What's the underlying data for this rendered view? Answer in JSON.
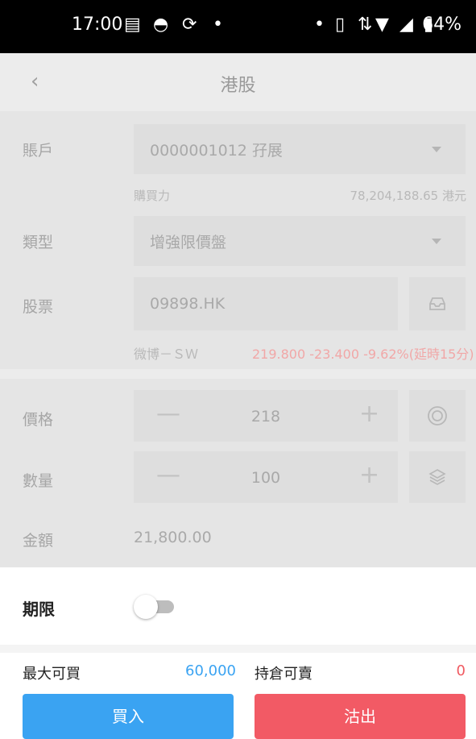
{
  "status_bar": {
    "time": "17:00",
    "battery": "64%",
    "left_icons": [
      "message-icon",
      "bowl-icon",
      "sync-icon",
      "dot-icon"
    ],
    "right_icons": [
      "dot-icon",
      "vibrate-icon",
      "data-icon",
      "wifi-icon",
      "signal-icon",
      "battery-icon"
    ]
  },
  "header": {
    "back_icon": "chevron-left-icon",
    "title": "港股"
  },
  "form": {
    "account_label": "賬戶",
    "account_value": "0000001012 孖展",
    "buying_power_label": "購買力",
    "buying_power_value": "78,204,188.65 港元",
    "type_label": "類型",
    "type_value": "增強限價盤",
    "stock_label": "股票",
    "stock_value": "09898.HK",
    "stock_name": "微博－ＳＷ",
    "quote": "219.800  -23.400  -9.62%(延時15分)",
    "price_label": "價格",
    "price_value": "218",
    "quantity_label": "數量",
    "quantity_value": "100",
    "amount_label": "金額",
    "amount_value": "21,800.00",
    "minus_symbol": "—",
    "plus_symbol": "+"
  },
  "validity": {
    "label": "期限",
    "enabled": false
  },
  "summary": {
    "max_buy_label": "最大可買",
    "max_buy_value": "60,000",
    "holding_sell_label": "持倉可賣",
    "holding_sell_value": "0"
  },
  "actions": {
    "buy_label": "買入",
    "sell_label": "沽出"
  },
  "colors": {
    "buy": "#3aa3f2",
    "sell": "#f25a65",
    "quote_red": "#f1a7a7"
  }
}
